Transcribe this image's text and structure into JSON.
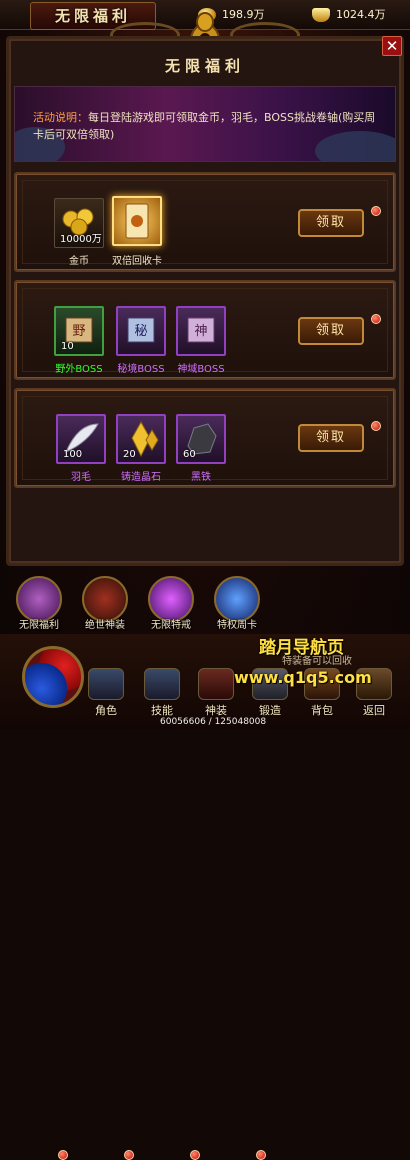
{
  "topbar": {
    "title": "无限福利",
    "gold": "198.9万",
    "ingot": "1024.4万"
  },
  "panel": {
    "title": "无限福利"
  },
  "banner": {
    "label": "活动说明：",
    "text": "每日登陆游戏即可领取金币，羽毛，BOSS挑战卷轴(购买周卡后可双倍领取)"
  },
  "cards": [
    {
      "button": "领取",
      "items": [
        {
          "label": "金币",
          "count": "10000万",
          "color": "#f0e6c8",
          "icon": "gold-coins-icon"
        },
        {
          "label": "双倍回收卡",
          "count": "",
          "color": "#f0e6c8",
          "icon": "recycle-card-icon"
        }
      ]
    },
    {
      "button": "领取",
      "items": [
        {
          "label": "野外BOSS",
          "count": "10",
          "color": "#30ff30",
          "icon": "field-boss-scroll-icon"
        },
        {
          "label": "秘境BOSS",
          "count": "",
          "color": "#d070ff",
          "icon": "secret-boss-scroll-icon"
        },
        {
          "label": "神域BOSS",
          "count": "",
          "color": "#d070ff",
          "icon": "divine-boss-scroll-icon"
        }
      ]
    },
    {
      "button": "领取",
      "items": [
        {
          "label": "羽毛",
          "count": "100",
          "color": "#d070ff",
          "icon": "feather-icon"
        },
        {
          "label": "铸造晶石",
          "count": "20",
          "color": "#d070ff",
          "icon": "forge-crystal-icon"
        },
        {
          "label": "黑铁",
          "count": "60",
          "color": "#d070ff",
          "icon": "black-iron-icon"
        }
      ]
    }
  ],
  "tabs": [
    {
      "label": "无限福利",
      "icon": "bag-icon"
    },
    {
      "label": "绝世神装",
      "icon": "warrior-icon"
    },
    {
      "label": "无限特戒",
      "icon": "ring-icon"
    },
    {
      "label": "特权周卡",
      "icon": "card-icon"
    }
  ],
  "nav": [
    {
      "label": "角色",
      "icon": "helmet-icon"
    },
    {
      "label": "技能",
      "icon": "skill-book-icon"
    },
    {
      "label": "神装",
      "icon": "armor-icon"
    },
    {
      "label": "锻造",
      "icon": "anvil-icon"
    },
    {
      "label": "背包",
      "icon": "backpack-icon"
    },
    {
      "label": "返回",
      "icon": "return-icon"
    }
  ],
  "watermark": {
    "line1": "踏月导航页",
    "line2": "www.q1q5.com"
  },
  "faded_text": "特装备可以回收",
  "footer": "60056606 / 125048008",
  "colors": {
    "gold": "#f4e2b0",
    "green": "#30ff30",
    "purple": "#d070ff",
    "orange": "#ffa040"
  }
}
